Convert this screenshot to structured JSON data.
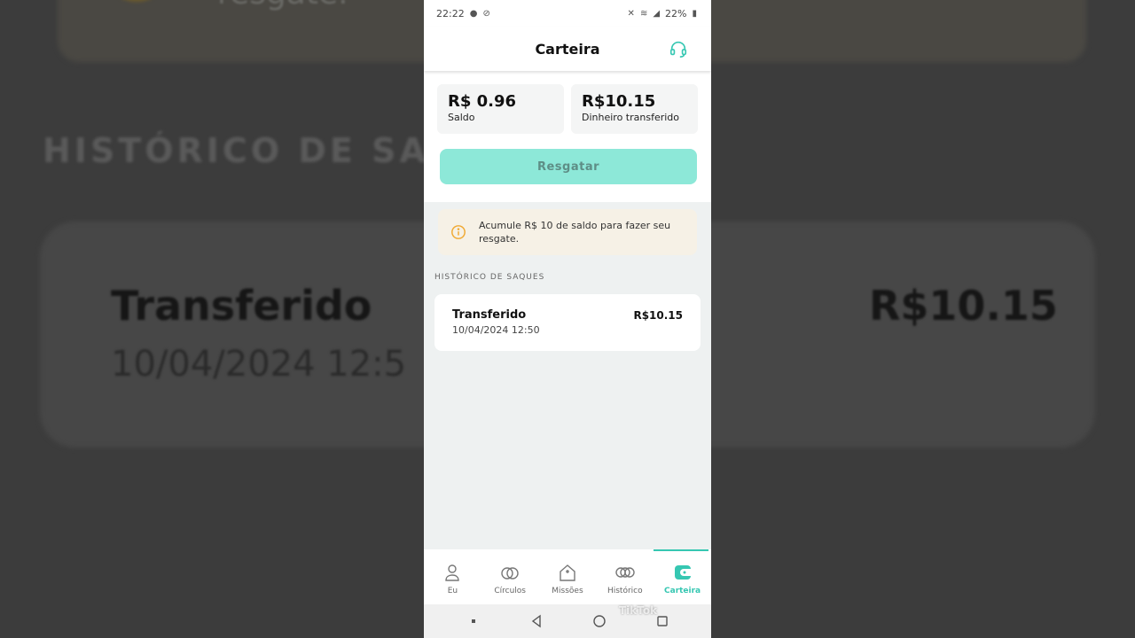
{
  "background": {
    "top_text": "resgate.",
    "heading": "HISTÓRICO DE SAQU",
    "card_title": "Transferido",
    "card_date": "10/04/2024 12:5",
    "card_amount": "R$10.15"
  },
  "statusbar": {
    "time": "22:22",
    "battery": "22%"
  },
  "header": {
    "title": "Carteira",
    "support_icon": "headset-icon"
  },
  "balance": {
    "saldo_amount": "R$ 0.96",
    "saldo_label": "Saldo",
    "transferred_amount": "R$10.15",
    "transferred_label": "Dinheiro transferido"
  },
  "redeem_button": {
    "label": "Resgatar"
  },
  "notice": {
    "text": "Acumule R$ 10 de saldo para fazer seu resgate.",
    "icon": "info-icon"
  },
  "history": {
    "section_title": "HISTÓRICO DE SAQUES",
    "items": [
      {
        "status": "Transferido",
        "date": "10/04/2024 12:50",
        "amount": "R$10.15"
      }
    ]
  },
  "bottom_nav": {
    "items": [
      {
        "label": "Eu",
        "icon": "person-icon",
        "active": false
      },
      {
        "label": "Círculos",
        "icon": "circles-icon",
        "active": false
      },
      {
        "label": "Missões",
        "icon": "house-tag-icon",
        "active": false
      },
      {
        "label": "Histórico",
        "icon": "coins-icon",
        "active": false
      },
      {
        "label": "Carteira",
        "icon": "wallet-icon",
        "active": true
      }
    ]
  },
  "watermark": "TikTok",
  "colors": {
    "accent": "#36c7b2",
    "button_disabled": "#8de8d8",
    "notice_bg": "#f6f1e6",
    "info_icon": "#f0a830"
  }
}
